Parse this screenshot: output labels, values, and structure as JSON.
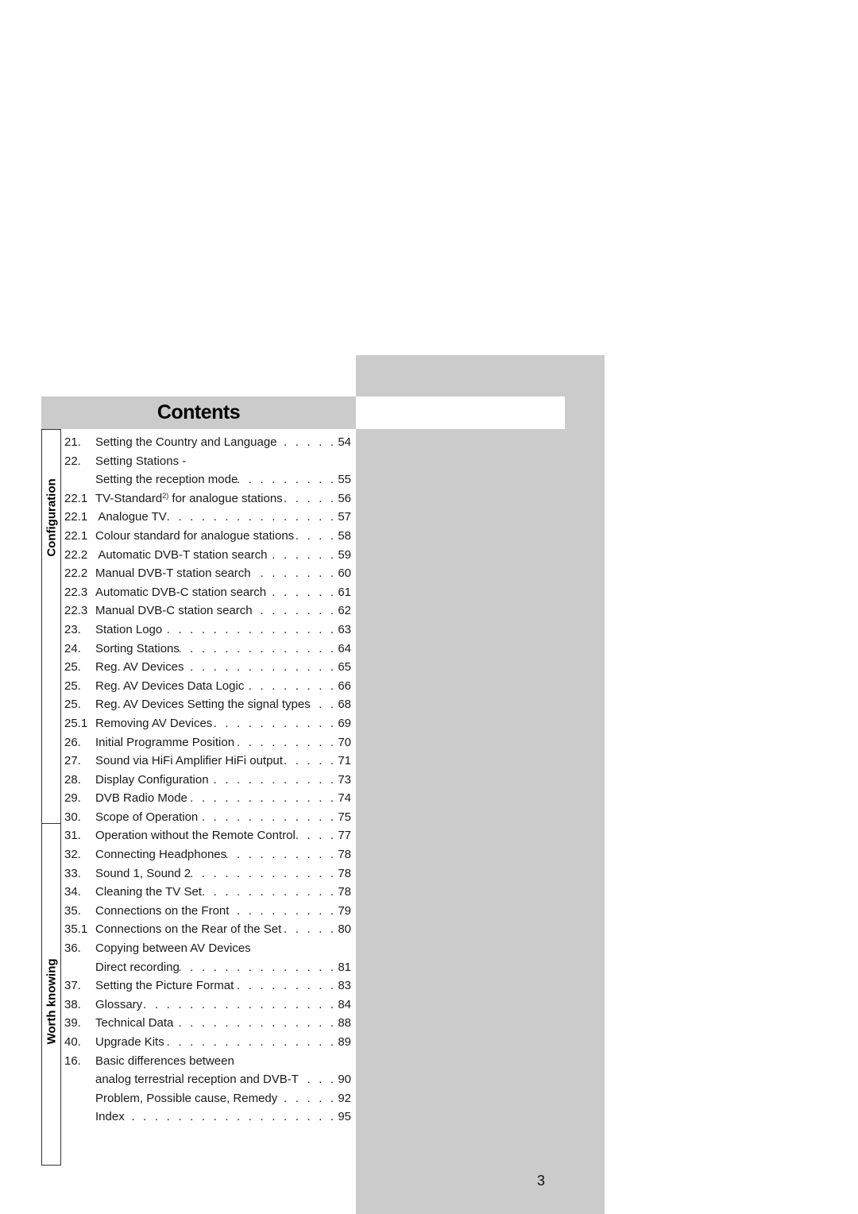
{
  "header": {
    "title": "Contents"
  },
  "sections": [
    {
      "label": "Configuration"
    },
    {
      "label": "Worth knowing"
    }
  ],
  "toc": [
    {
      "num": "21.",
      "title": "Setting the Country and Language",
      "page": "54"
    },
    {
      "num": "22.",
      "title": "Setting Stations -",
      "page": ""
    },
    {
      "num": "",
      "title": "Setting the reception mode",
      "page": "55"
    },
    {
      "num": "22.1",
      "title": "TV-Standard",
      "sup": "2)",
      "title_rest": " for analogue stations",
      "page": "56"
    },
    {
      "num": "22.1",
      "title": " Analogue TV",
      "page": "57"
    },
    {
      "num": "22.1",
      "title": "Colour standard for analogue stations",
      "page": "58"
    },
    {
      "num": "22.2",
      "title": " Automatic DVB-T station search",
      "page": "59"
    },
    {
      "num": "22.2",
      "title": "Manual DVB-T station search",
      "page": "60"
    },
    {
      "num": "22.3",
      "title": "Automatic DVB-C station search",
      "page": "61"
    },
    {
      "num": "22.3",
      "title": "Manual DVB-C station search",
      "page": "62"
    },
    {
      "num": "23.",
      "title": "Station Logo",
      "page": "63"
    },
    {
      "num": "24.",
      "title": "Sorting Stations",
      "page": "64"
    },
    {
      "num": "25.",
      "title": "Reg. AV Devices",
      "page": "65"
    },
    {
      "num": "25.",
      "title": "Reg. AV Devices Data Logic",
      "page": "66"
    },
    {
      "num": "25.",
      "title": "Reg. AV Devices Setting the signal types",
      "page": "68"
    },
    {
      "num": "25.1",
      "title": "Removing AV Devices",
      "page": "69"
    },
    {
      "num": "26.",
      "title": "Initial Programme Position",
      "page": "70"
    },
    {
      "num": "27.",
      "title": "Sound via HiFi Amplifier HiFi output",
      "page": "71"
    },
    {
      "num": "28.",
      "title": "Display Configuration",
      "page": "73"
    },
    {
      "num": "29.",
      "title": "DVB Radio Mode",
      "page": "74"
    },
    {
      "num": "30.",
      "title": "Scope of Operation",
      "page": "75"
    },
    {
      "num": "31.",
      "title": "Operation without the Remote Control",
      "page": "77"
    },
    {
      "num": "32.",
      "title": "Connecting Headphones",
      "page": "78"
    },
    {
      "num": "33.",
      "title": "Sound 1, Sound 2",
      "page": "78"
    },
    {
      "num": "34.",
      "title": "Cleaning the TV Set",
      "page": "78"
    },
    {
      "num": "35.",
      "title": "Connections on the Front",
      "page": "79"
    },
    {
      "num": "35.1",
      "title": "Connections on the Rear of the Set",
      "page": "80"
    },
    {
      "num": "36.",
      "title": "Copying between AV Devices",
      "page": ""
    },
    {
      "num": "",
      "title": "Direct recording",
      "page": "81"
    },
    {
      "num": "37.",
      "title": "Setting the Picture Format",
      "page": "83"
    },
    {
      "num": "38.",
      "title": "Glossary",
      "page": "84"
    },
    {
      "num": "39.",
      "title": "Technical Data",
      "page": "88"
    },
    {
      "num": "40.",
      "title": "Upgrade Kits",
      "page": "89"
    },
    {
      "num": "16.",
      "title": "Basic differences between",
      "page": ""
    },
    {
      "num": "",
      "title": "analog terrestrial reception and DVB-T",
      "page": "90"
    },
    {
      "num": "",
      "title": "Problem, Possible cause, Remedy",
      "page": "92"
    },
    {
      "num": "",
      "title": "Index",
      "page": "95"
    }
  ],
  "footer": {
    "page_number": "3"
  },
  "colors": {
    "panel_gray": "#cbcbcb",
    "text": "#1a1a1a"
  }
}
